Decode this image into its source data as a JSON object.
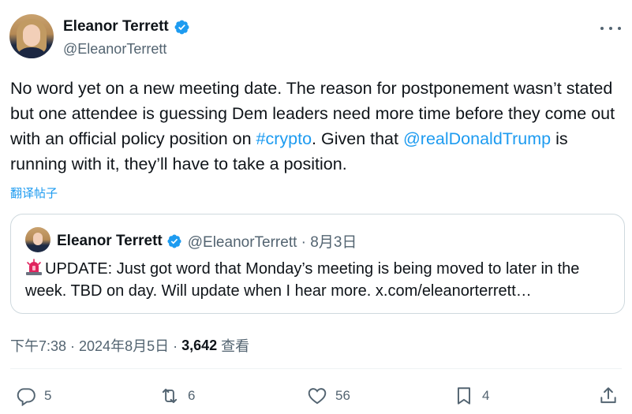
{
  "author": {
    "display_name": "Eleanor Terrett",
    "handle": "@EleanorTerrett",
    "verified_icon": "verified-badge-icon"
  },
  "tweet": {
    "text_parts": [
      "No word yet on a new meeting date. The reason for postponement wasn’t stated but one attendee is guessing Dem leaders need more time before they come out with an official policy position on ",
      "#crypto",
      ". Given that ",
      "@realDonaldTrump",
      " is running with it, they’ll have to take a position."
    ],
    "translate_label": "翻译帖子"
  },
  "quote": {
    "display_name": "Eleanor Terrett",
    "handle_and_date": "@EleanorTerrett · 8月3日",
    "text": "UPDATE: Just got word that Monday’s meeting is being moved to later in the week. TBD on day. Will update when I hear more. x.com/eleanorterrett…"
  },
  "meta": {
    "time_date": "下午7:38 · 2024年8月5日 ·",
    "views_count": "3,642",
    "views_label": "查看"
  },
  "actions": {
    "reply_count": "5",
    "retweet_count": "6",
    "like_count": "56",
    "bookmark_count": "4"
  },
  "colors": {
    "accent": "#1d9bf0",
    "secondary_text": "#536471",
    "border": "#cfd9de"
  }
}
